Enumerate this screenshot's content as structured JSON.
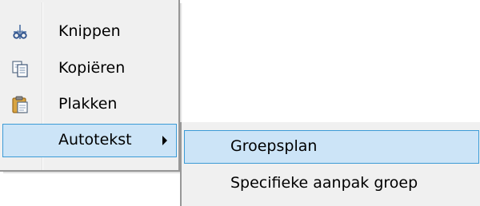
{
  "context_menu": {
    "items": [
      {
        "label": "Knippen",
        "icon": "scissors-icon"
      },
      {
        "label": "Kopiëren",
        "icon": "copy-icon"
      },
      {
        "label": "Plakken",
        "icon": "paste-icon"
      },
      {
        "label": "Autotekst",
        "icon": "",
        "has_submenu": true,
        "highlighted": true
      }
    ]
  },
  "submenu": {
    "items": [
      {
        "label": "Groepsplan",
        "highlighted": true
      },
      {
        "label": "Specifieke aanpak groep"
      }
    ]
  },
  "colors": {
    "menu_background": "#f0f0f0",
    "highlight_background": "#cce4f7",
    "highlight_border": "#3c9bd6",
    "menu_border": "#979797"
  }
}
